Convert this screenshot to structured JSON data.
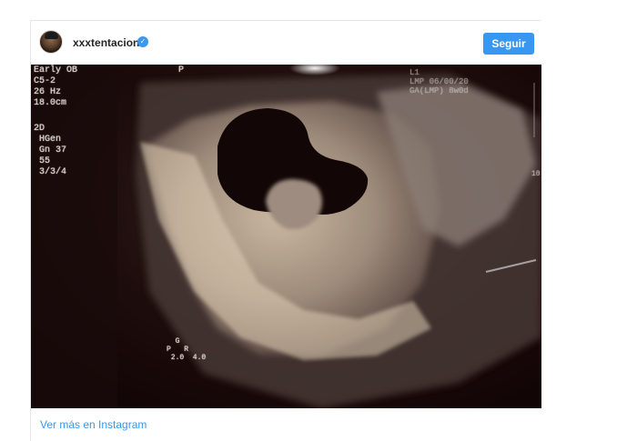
{
  "post": {
    "username": "xxxtentacion",
    "follow_label": "Seguir",
    "more_link": "Ver más en Instagram"
  },
  "ultrasound": {
    "left_block": "Early OB\nC5-2\n26 Hz\n18.0cm",
    "left_block2": "2D\n HGen\n Gn 37\n 55\n 3/3/4",
    "top_marker": "P",
    "right_block": "L1\nLMP 06/00/20\nGA(LMP) 8w0d",
    "scale_block": "  G\nP   R\n 2.0  4.0",
    "side_number": "10"
  },
  "colors": {
    "accent": "#3897f0"
  }
}
